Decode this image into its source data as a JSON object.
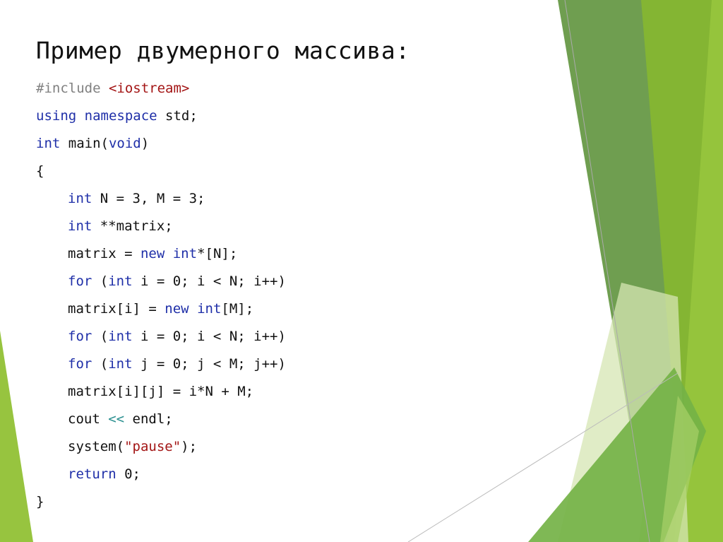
{
  "slide": {
    "title": "Пример двумерного массива:",
    "code_lines": [
      {
        "indent": false,
        "tokens": [
          {
            "t": "#include ",
            "c": "pp"
          },
          {
            "t": "<iostream>",
            "c": "inc"
          }
        ]
      },
      {
        "indent": false,
        "tokens": [
          {
            "t": "using",
            "c": "kw"
          },
          {
            "t": " "
          },
          {
            "t": "namespace",
            "c": "kw"
          },
          {
            "t": " std;"
          }
        ]
      },
      {
        "indent": false,
        "tokens": [
          {
            "t": "int",
            "c": "kw"
          },
          {
            "t": " main("
          },
          {
            "t": "void",
            "c": "kw"
          },
          {
            "t": ")"
          }
        ]
      },
      {
        "indent": false,
        "tokens": [
          {
            "t": "{"
          }
        ]
      },
      {
        "indent": true,
        "tokens": [
          {
            "t": "int",
            "c": "kw"
          },
          {
            "t": " N = 3, M = 3;"
          }
        ]
      },
      {
        "indent": true,
        "tokens": [
          {
            "t": "int",
            "c": "kw"
          },
          {
            "t": " **matrix;"
          }
        ]
      },
      {
        "indent": true,
        "tokens": [
          {
            "t": "matrix = "
          },
          {
            "t": "new",
            "c": "kw"
          },
          {
            "t": " "
          },
          {
            "t": "int",
            "c": "kw"
          },
          {
            "t": "*[N];"
          }
        ]
      },
      {
        "indent": true,
        "tokens": [
          {
            "t": "for",
            "c": "kw"
          },
          {
            "t": " ("
          },
          {
            "t": "int",
            "c": "kw"
          },
          {
            "t": " i = 0; i < N; i++)"
          }
        ]
      },
      {
        "indent": true,
        "tokens": [
          {
            "t": "matrix[i] = "
          },
          {
            "t": "new",
            "c": "kw"
          },
          {
            "t": " "
          },
          {
            "t": "int",
            "c": "kw"
          },
          {
            "t": "[M];"
          }
        ]
      },
      {
        "indent": true,
        "tokens": [
          {
            "t": "for",
            "c": "kw"
          },
          {
            "t": " ("
          },
          {
            "t": "int",
            "c": "kw"
          },
          {
            "t": " i = 0; i < N; i++)"
          }
        ]
      },
      {
        "indent": true,
        "tokens": [
          {
            "t": "for",
            "c": "kw"
          },
          {
            "t": " ("
          },
          {
            "t": "int",
            "c": "kw"
          },
          {
            "t": " j = 0; j < M; j++)"
          }
        ]
      },
      {
        "indent": true,
        "tokens": [
          {
            "t": "matrix[i][j] = i*N + M;"
          }
        ]
      },
      {
        "indent": true,
        "tokens": [
          {
            "t": "cout "
          },
          {
            "t": "<<",
            "c": "op"
          },
          {
            "t": " endl;"
          }
        ]
      },
      {
        "indent": true,
        "tokens": [
          {
            "t": "system("
          },
          {
            "t": "\"pause\"",
            "c": "str"
          },
          {
            "t": ");"
          }
        ]
      },
      {
        "indent": true,
        "tokens": [
          {
            "t": "return",
            "c": "kw"
          },
          {
            "t": " 0;"
          }
        ]
      },
      {
        "indent": false,
        "tokens": [
          {
            "t": "}"
          }
        ]
      }
    ]
  },
  "theme": {
    "keyword": "#1f2fa8",
    "preprocessor": "#808080",
    "include_target": "#a31515",
    "string": "#a31515",
    "operator": "#2b9090",
    "green_dark": "#6a9d4a",
    "green_mid": "#84b533",
    "green_light": "#95c43c",
    "green_pale": "#dde9c2"
  }
}
